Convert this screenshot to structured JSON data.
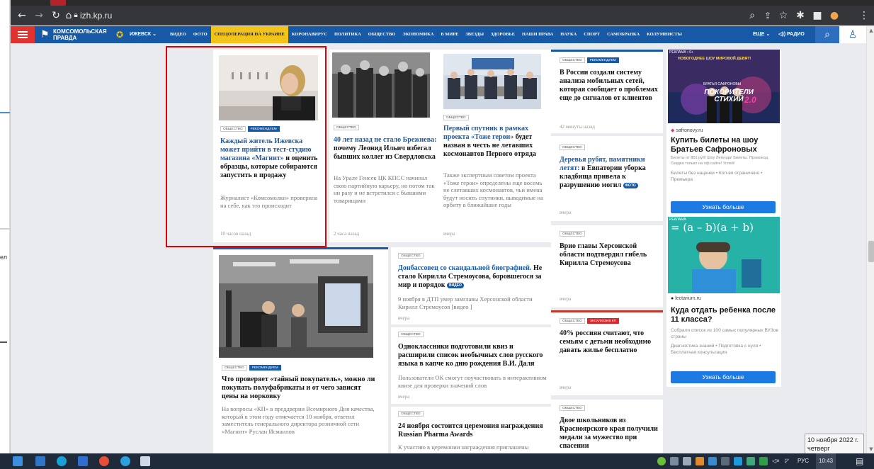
{
  "left_window": {
    "texts": [
      "ел"
    ]
  },
  "browser": {
    "url": "izh.kp.ru",
    "nav_icons": [
      "back-arrow-icon",
      "forward-arrow-icon",
      "reload-icon",
      "home-icon",
      "lock-icon"
    ],
    "toolbar_right_icons": [
      "zoom-icon",
      "share-icon",
      "star-icon",
      "extensions-icon",
      "sidebar-icon",
      "profile-icon",
      "menu-dots-icon"
    ]
  },
  "site": {
    "logo_line1": "КОМСОМОЛЬСКАЯ",
    "logo_line2": "ПРАВДА",
    "city": "ИЖЕВСК",
    "nav": [
      "ВИДЕО",
      "ФОТО",
      "СПЕЦОПЕРАЦИЯ НА УКРАИНЕ",
      "КОРОНАВИРУС",
      "ПОЛИТИКА",
      "ОБЩЕСТВО",
      "ЭКОНОМИКА",
      "В МИРЕ",
      "ЗВЕЗДЫ",
      "ЗДОРОВЬЕ",
      "НАШИ ПРАВА",
      "НАУКА",
      "СПОРТ",
      "САМОБРАНКА",
      "КОЛУМНИСТЫ"
    ],
    "more": "ЕЩЕ",
    "radio": "РАДИО"
  },
  "cards": {
    "c1": {
      "tags": [
        "ОБЩЕСТВО",
        "РЕКОМЕНДУЕМ"
      ],
      "title_link": "Каждый житель Ижевска может прийти в тест-студию магазина «Магнит»",
      "title_rest": " и оценить образцы, которые собираются запустить в продажу",
      "lead": "Журналист «Комсомолки» проверила на себе, как это происходит",
      "time": "10 часов назад"
    },
    "c2": {
      "tags": [
        "ОБЩЕСТВО"
      ],
      "title_link": "40 лет назад не стало Брежнева:",
      "title_rest": " почему Леонид Ильич избегал бывших коллег из Свердловска",
      "lead": "На Урале Генсек ЦК КПСС начинал свою партийную карьеру, но потом так ни разу и не встретился с бывшими товарищами",
      "time": "2 часа назад"
    },
    "c3": {
      "tags": [
        "ОБЩЕСТВО"
      ],
      "title_link": "Первый спутник в рамках проекта «Тоже герои»",
      "title_rest": " будет назван в честь не летавших космонавтов Первого отряда",
      "lead": "Также экспертным советом проекта «Тоже герои» определены еще восемь не слетавших космонавтов, чьи имена будут носить спутники, выводимые на орбиту в ближайшие годы",
      "time": "вчера"
    },
    "c4": {
      "tags": [
        "ОБЩЕСТВО",
        "РЕКОМЕНДУЕМ"
      ],
      "title": "В России создали систему анализа мобильных сетей, которая сообщает о проблемах еще до сигналов от клиентов",
      "time": "42 минуты назад"
    },
    "c5": {
      "tags": [
        "ОБЩЕСТВО"
      ],
      "title_link": "Деревья рубят, памятники летят:",
      "title_rest": " в Евпатории уборка кладбища привела к разрушению могил",
      "badge": "ФОТО",
      "time": "вчера"
    },
    "c6": {
      "tags": [
        "ОБЩЕСТВО"
      ],
      "title": "Врио главы Херсонской области подтвердил гибель Кирилла Стремоусова",
      "time": "вчера"
    },
    "c7": {
      "tags": [
        "ОБЩЕСТВО",
        "ЭКСКЛЮЗИВ КП"
      ],
      "title": "40% россиян считают, что семьям с детьми необходимо давать жилье бесплатно",
      "time": "вчера"
    },
    "c8": {
      "tags": [
        "ОБЩЕСТВО"
      ],
      "title": "Двое школьников из Красноярского края получили медали за мужество при спасении"
    },
    "c9": {
      "tags": [
        "ОБЩЕСТВО",
        "РЕКОМЕНДУЕМ"
      ],
      "title": "Что проверяет «тайный покупатель», можно ли покупать полуфабрикаты и от чего зависят цены на морковку",
      "lead": "На вопросы «КП» в преддверии Всемирного Дня качества, который в этом году отмечается 10 ноября, ответил заместитель генерального директора розничной сети «Магнит» Руслан Исмаилов"
    },
    "c10": {
      "tags": [
        "ОБЩЕСТВО"
      ],
      "title_link": "Донбассовец со скандальной биографией.",
      "title_rest": " Не стало Кирилла Стремоусова, боровшегося за мир и порядок",
      "badge": "ВИДЕО",
      "lead": "9 ноября в ДТП умер замглавы Херсонской области Кирилл Стремоусов [видео ]",
      "time": "вчера"
    },
    "c11": {
      "tags": [
        "ОБЩЕСТВО"
      ],
      "title": "Одноклассники подготовили квиз и расширили список необычных слов русского языка в капче ко дню рождения В.И. Даля",
      "lead": "Пользователи ОК смогут поучаствовать в интерактивном квизе для проверки значений слов",
      "time": "вчера"
    },
    "c12": {
      "tags": [
        "ОБЩЕСТВО"
      ],
      "title": "24 ноября состоится церемония награждения Russian Pharma Awards",
      "lead": "К участию в церемонии награждения приглашены"
    }
  },
  "ads": {
    "a1": {
      "label": "РЕКЛАМА • 0+",
      "banner_top": "НОВОГОДНЕЕ ШОУ МИРОВОЙ ДЕВЯТ!",
      "banner_name": "БРАТЬЯ САФРОНОВЫ",
      "banner_big": "ПОКОРИТЕЛИ СТИХИЙ",
      "banner_num": "2.0",
      "domain": "safronovy.ru",
      "title": "Купить билеты на шоу Братьев Сафроновых",
      "small": "Билеты от 801 руб! Шоу Легенда! Билеты. Промокод. Скидка только на оф.сайте! Успей!",
      "line2": "Билеты без наценки • Кол-во ограничено • Премьера",
      "button": "Узнать больше"
    },
    "a2": {
      "label": "РЕКЛАМА",
      "formula": "= (a – b)(a + b)",
      "domain": "lectarium.ru",
      "title": "Куда отдать ребенка после 11 класса?",
      "small": "Собрали список из 100 самых популярных ВУЗов страны",
      "line2": "Диагностика знаний • Подготовка с нуля • Бесплатная консультация",
      "button": "Узнать больше"
    }
  },
  "taskbar": {
    "lang": "РУС",
    "clock": "10:43",
    "date_line1": "10 ноября 2022 г.",
    "date_line2": "четверг"
  },
  "colors": {
    "brand_blue": "#1859a6",
    "accent_yellow": "#f2c318",
    "highlight_red": "#e20000",
    "link_blue": "#1a5aa6"
  }
}
